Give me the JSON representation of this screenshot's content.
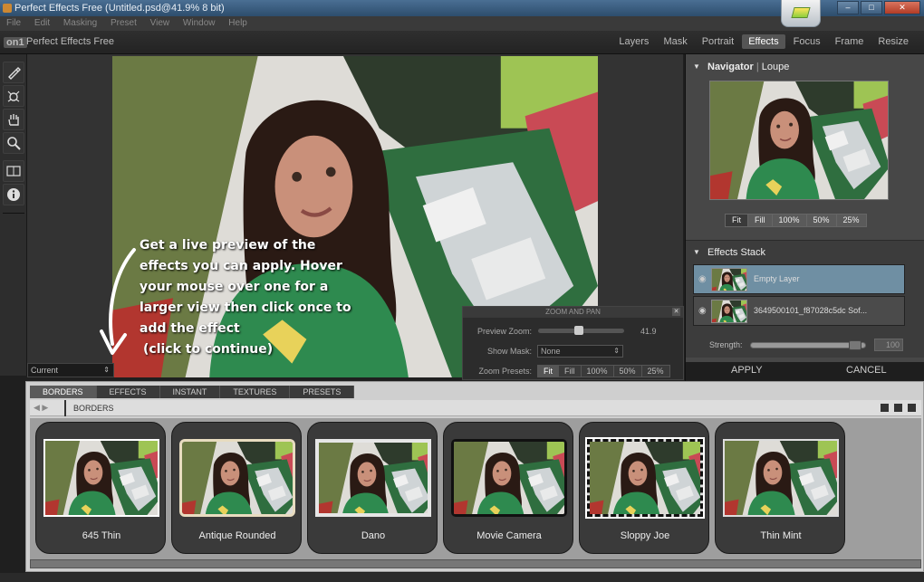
{
  "window": {
    "title": "Perfect Effects Free (Untitled.psd@41.9% 8 bit)"
  },
  "menu": [
    "File",
    "Edit",
    "Masking",
    "Preset",
    "View",
    "Window",
    "Help"
  ],
  "app": {
    "logo": "on1",
    "name": "Perfect Effects Free"
  },
  "modules": [
    {
      "label": "Layers",
      "active": false
    },
    {
      "label": "Mask",
      "active": false
    },
    {
      "label": "Portrait",
      "active": false
    },
    {
      "label": "Effects",
      "active": true
    },
    {
      "label": "Focus",
      "active": false
    },
    {
      "label": "Frame",
      "active": false
    },
    {
      "label": "Resize",
      "active": false
    }
  ],
  "tools": [
    "brush-icon",
    "masking-bug-icon",
    "hand-icon",
    "zoom-icon",
    "compare-icon",
    "info-icon"
  ],
  "canvas": {
    "view_select": "Current",
    "tooltip": {
      "lines": [
        "Get a live preview of the",
        "effects you can apply. Hover",
        "your mouse over one for a",
        "larger view then click once to",
        "add the effect"
      ],
      "sub": "(click to continue)"
    }
  },
  "zoom_pan": {
    "title": "ZOOM AND PAN",
    "preview_zoom_label": "Preview Zoom:",
    "preview_zoom_value": "41.9",
    "show_mask_label": "Show Mask:",
    "show_mask_value": "None",
    "zoom_presets_label": "Zoom Presets:",
    "presets": [
      "Fit",
      "Fill",
      "100%",
      "50%",
      "25%"
    ]
  },
  "navigator": {
    "title": "Navigator",
    "tab2": "Loupe",
    "buttons": [
      "Fit",
      "Fill",
      "100%",
      "50%",
      "25%"
    ]
  },
  "effects_stack": {
    "title": "Effects Stack",
    "layers": [
      {
        "name": "Empty Layer",
        "selected": true
      },
      {
        "name": "3649500101_f87028c5dc Sof...",
        "selected": false
      }
    ],
    "strength_label": "Strength:",
    "strength_value": "100",
    "apply": "APPLY",
    "cancel": "CANCEL"
  },
  "browser": {
    "tabs": [
      {
        "label": "BORDERS",
        "active": true
      },
      {
        "label": "EFFECTS",
        "active": false
      },
      {
        "label": "INSTANT",
        "active": false
      },
      {
        "label": "TEXTURES",
        "active": false
      },
      {
        "label": "PRESETS",
        "active": false
      }
    ],
    "path": "BORDERS",
    "presets": [
      "645 Thin",
      "Antique Rounded",
      "Dano",
      "Movie Camera",
      "Sloppy Joe",
      "Thin Mint"
    ]
  }
}
